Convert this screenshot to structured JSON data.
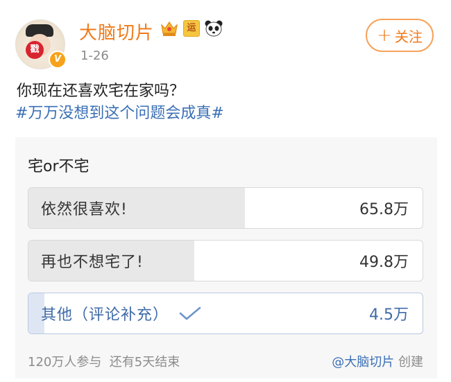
{
  "post": {
    "username": "大脑切片",
    "date": "1-26",
    "follow_label": "关注",
    "avatar_seal": "戳",
    "verified_mark": "V",
    "badge_text": "运",
    "text": "你现在还喜欢宅在家吗？",
    "hashtag": "#万万没想到这个问题会成真#"
  },
  "poll": {
    "title": "宅or不宅",
    "options": [
      {
        "label": "依然很喜欢!",
        "count": "65.8万",
        "fraction": 0.55,
        "selected": false
      },
      {
        "label": "再也不想宅了!",
        "count": "49.8万",
        "fraction": 0.42,
        "selected": false
      },
      {
        "label": "其他（评论补充）",
        "count": "4.5万",
        "fraction": 0.04,
        "selected": true
      }
    ],
    "footer_left": "120万人参与  还有5天结束",
    "footer_creator": "@大脑切片",
    "footer_created": " 创建"
  },
  "colors": {
    "accent": "#f07a1a",
    "link": "#3a6fb5",
    "selected": "#3f6aa8"
  }
}
